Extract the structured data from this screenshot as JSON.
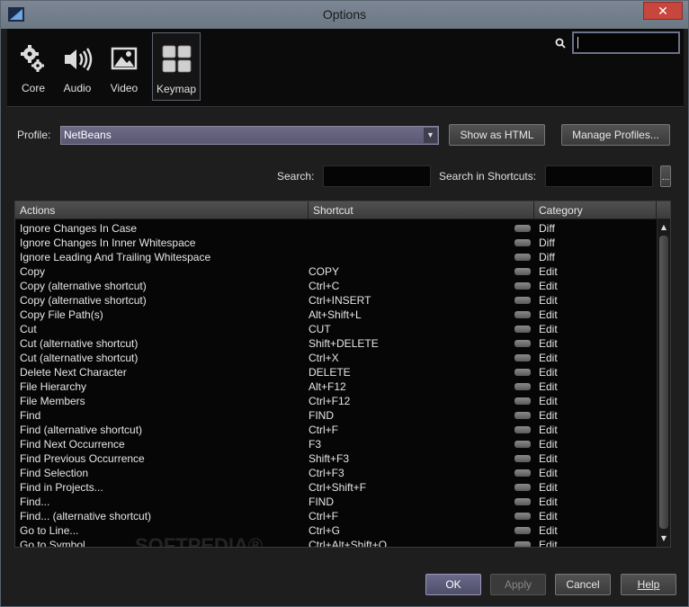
{
  "window": {
    "title": "Options",
    "close_glyph": "✕"
  },
  "categories": [
    {
      "label": "Core",
      "icon": "gear-icon"
    },
    {
      "label": "Audio",
      "icon": "speaker-icon"
    },
    {
      "label": "Video",
      "icon": "image-icon"
    },
    {
      "label": "Keymap",
      "icon": "keyboard-icon",
      "selected": true
    }
  ],
  "top_search": {
    "value": ""
  },
  "profile": {
    "label": "Profile:",
    "selected": "NetBeans",
    "show_html_label": "Show as HTML",
    "manage_profiles_label": "Manage Profiles..."
  },
  "search": {
    "search_label": "Search:",
    "search_value": "",
    "shortcuts_label": "Search in Shortcuts:",
    "shortcuts_value": "",
    "more_label": "..."
  },
  "table": {
    "columns": [
      "Actions",
      "Shortcut",
      "Category"
    ],
    "rows": [
      [
        "Ignore Changes In Case",
        "",
        "Diff"
      ],
      [
        "Ignore Changes In Inner Whitespace",
        "",
        "Diff"
      ],
      [
        "Ignore Leading And Trailing Whitespace",
        "",
        "Diff"
      ],
      [
        "Copy",
        "COPY",
        "Edit"
      ],
      [
        "Copy (alternative shortcut)",
        "Ctrl+C",
        "Edit"
      ],
      [
        "Copy (alternative shortcut)",
        "Ctrl+INSERT",
        "Edit"
      ],
      [
        "Copy File Path(s)",
        "Alt+Shift+L",
        "Edit"
      ],
      [
        "Cut",
        "CUT",
        "Edit"
      ],
      [
        "Cut (alternative shortcut)",
        "Shift+DELETE",
        "Edit"
      ],
      [
        "Cut (alternative shortcut)",
        "Ctrl+X",
        "Edit"
      ],
      [
        "Delete Next Character",
        "DELETE",
        "Edit"
      ],
      [
        "File Hierarchy",
        "Alt+F12",
        "Edit"
      ],
      [
        "File Members",
        "Ctrl+F12",
        "Edit"
      ],
      [
        "Find",
        "FIND",
        "Edit"
      ],
      [
        "Find (alternative shortcut)",
        "Ctrl+F",
        "Edit"
      ],
      [
        "Find Next Occurrence",
        "F3",
        "Edit"
      ],
      [
        "Find Previous Occurrence",
        "Shift+F3",
        "Edit"
      ],
      [
        "Find Selection",
        "Ctrl+F3",
        "Edit"
      ],
      [
        "Find in Projects...",
        "Ctrl+Shift+F",
        "Edit"
      ],
      [
        "Find...",
        "FIND",
        "Edit"
      ],
      [
        "Find... (alternative shortcut)",
        "Ctrl+F",
        "Edit"
      ],
      [
        "Go to Line...",
        "Ctrl+G",
        "Edit"
      ],
      [
        "Go to Symbol...",
        "Ctrl+Alt+Shift+O",
        "Edit"
      ]
    ]
  },
  "watermark": "SOFTPEDIA®",
  "buttons": {
    "ok": "OK",
    "apply": "Apply",
    "cancel": "Cancel",
    "help": "Help"
  }
}
